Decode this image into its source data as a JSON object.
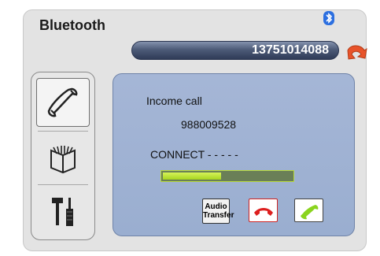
{
  "app": {
    "title": "Bluetooth"
  },
  "status": {
    "phone_number": "13751014088"
  },
  "nav": {
    "items": [
      {
        "name": "phone",
        "icon": "phone-handset-icon"
      },
      {
        "name": "contacts",
        "icon": "book-icon"
      },
      {
        "name": "settings",
        "icon": "tools-icon"
      }
    ]
  },
  "call": {
    "heading": "Income call",
    "caller_number": "988009528",
    "status_text": "CONNECT - - - - -",
    "progress": 0.45,
    "audio_transfer_label_1": "Audio",
    "audio_transfer_label_2": "Transfer"
  },
  "colors": {
    "accent": "#2f3b57",
    "hangup": "#dd1f1f",
    "answer": "#8ad41e",
    "progress": "#c4ec3a"
  }
}
